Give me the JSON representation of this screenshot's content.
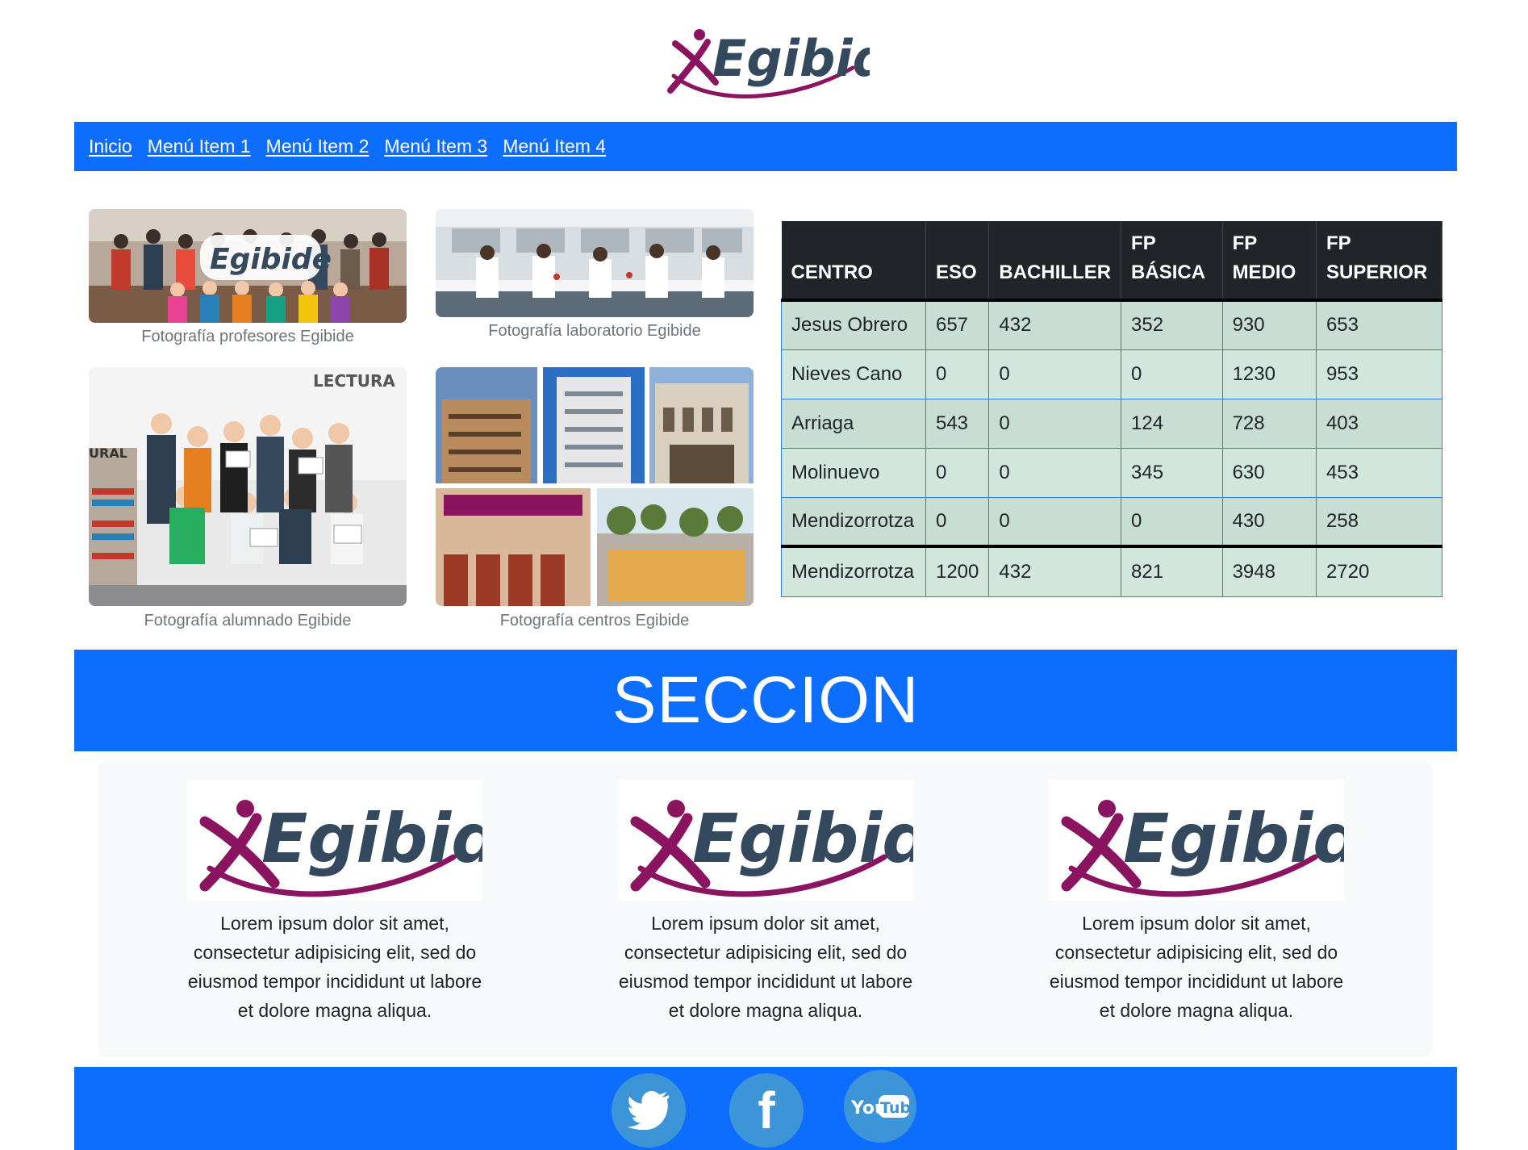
{
  "brand": {
    "name": "Egibide",
    "color_x": "#8a1460",
    "color_text": "#34495e"
  },
  "nav": {
    "items": [
      {
        "label": "Inicio"
      },
      {
        "label": "Menú Item 1"
      },
      {
        "label": "Menú Item 2"
      },
      {
        "label": "Menú Item 3"
      },
      {
        "label": "Menú Item 4"
      }
    ]
  },
  "gallery": {
    "captions": [
      "Fotografía profesores Egibide",
      "Fotografía laboratorio Egibide",
      "Fotografía alumnado Egibide",
      "Fotografía centros Egibide"
    ],
    "photo_signs": [
      "LECTURA",
      "URAL"
    ]
  },
  "table": {
    "headers": [
      "CENTRO",
      "ESO",
      "BACHILLER",
      "FP BÁSICA",
      "FP MEDIO",
      "FP SUPERIOR"
    ],
    "rows": [
      [
        "Jesus Obrero",
        "657",
        "432",
        "352",
        "930",
        "653"
      ],
      [
        "Nieves Cano",
        "0",
        "0",
        "0",
        "1230",
        "953"
      ],
      [
        "Arriaga",
        "543",
        "0",
        "124",
        "728",
        "403"
      ],
      [
        "Molinuevo",
        "0",
        "0",
        "345",
        "630",
        "453"
      ],
      [
        "Mendizorrotza",
        "0",
        "0",
        "0",
        "430",
        "258"
      ]
    ],
    "footer": [
      "Mendizorrotza",
      "1200",
      "432",
      "821",
      "3948",
      "2720"
    ]
  },
  "section": {
    "title": "SECCION"
  },
  "cards": [
    {
      "text": "Lorem ipsum dolor sit amet, consectetur adipisicing elit, sed do eiusmod tempor incididunt ut labore et dolore magna aliqua."
    },
    {
      "text": "Lorem ipsum dolor sit amet, consectetur adipisicing elit, sed do eiusmod tempor incididunt ut labore et dolore magna aliqua."
    },
    {
      "text": "Lorem ipsum dolor sit amet, consectetur adipisicing elit, sed do eiusmod tempor incididunt ut labore et dolore magna aliqua."
    }
  ],
  "social": {
    "icons": [
      "twitter-icon",
      "facebook-icon",
      "youtube-icon"
    ],
    "facebook_glyph": "f",
    "youtube_you": "You",
    "youtube_tube": "Tube"
  }
}
